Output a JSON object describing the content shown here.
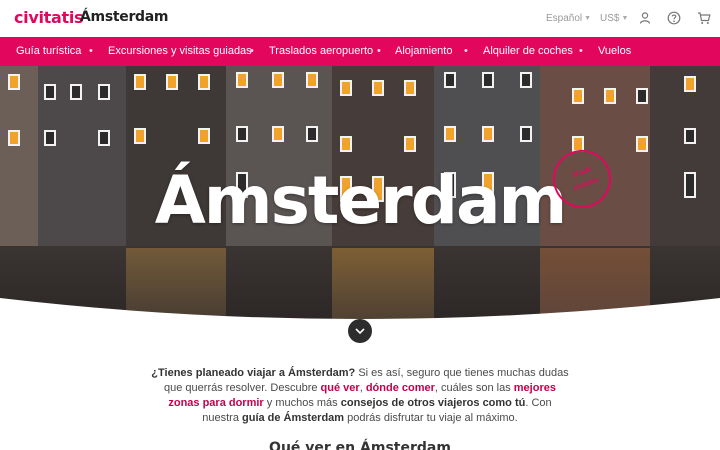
{
  "header": {
    "logo": "civitatis",
    "city": "Ámsterdam",
    "language": "Español",
    "currency": "US$",
    "icons": [
      "user-icon",
      "help-icon",
      "cart-icon"
    ]
  },
  "nav": {
    "items": [
      "Guía turística",
      "Excursiones y visitas guiadas",
      "Traslados aeropuerto",
      "Alojamiento",
      "Alquiler de coches",
      "Vuelos"
    ],
    "separator": "•"
  },
  "hero": {
    "title": "Ámsterdam",
    "stamp_top": "TOUR",
    "stamp_brand": "civitatis"
  },
  "intro": {
    "q": "¿Tienes planeado viajar a Ámsterdam?",
    "t1": " Si es así, seguro que tienes muchas dudas que querrás resolver. Descubre ",
    "l1": "qué ver",
    "t2": ", ",
    "l2": "dónde comer",
    "t3": ", cuáles son las ",
    "l3": "mejores zonas para dormir",
    "t4": " y muchos más ",
    "b2": "consejos de otros viajeros como tú",
    "t5": ". Con nuestra ",
    "b3": "guía de Ámsterdam",
    "t6": " podrás disfrutar tu viaje al máximo."
  },
  "next_heading": "Qué ver en Ámsterdam",
  "colors": {
    "brand": "#e2075d",
    "link": "#c6004d",
    "dark_button": "#2d2d2d"
  }
}
